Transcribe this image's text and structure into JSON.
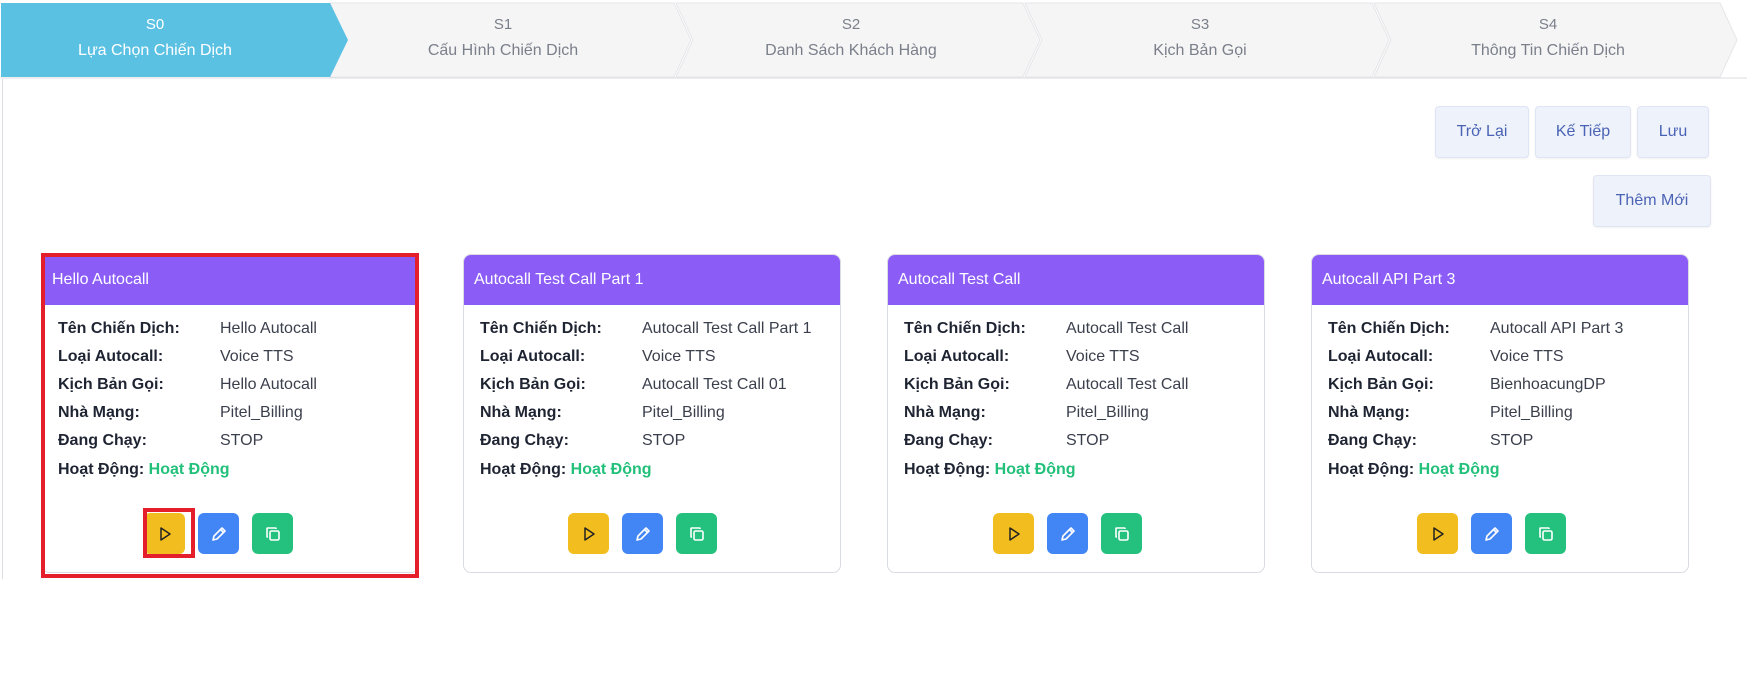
{
  "steps": [
    {
      "code": "S0",
      "name": "Lựa Chọn Chiến Dịch",
      "active": true
    },
    {
      "code": "S1",
      "name": "Cấu Hình Chiến Dịch",
      "active": false
    },
    {
      "code": "S2",
      "name": "Danh Sách Khách Hàng",
      "active": false
    },
    {
      "code": "S3",
      "name": "Kịch Bản Gọi",
      "active": false
    },
    {
      "code": "S4",
      "name": "Thông Tin Chiến Dịch",
      "active": false
    }
  ],
  "actions": {
    "back_label": "Trở Lại",
    "next_label": "Kế Tiếp",
    "save_label": "Lưu",
    "add_label": "Thêm Mới"
  },
  "field_labels": {
    "name": "Tên Chiến Dịch:",
    "type": "Loại Autocall:",
    "script": "Kịch Bản Gọi:",
    "carrier": "Nhà Mạng:",
    "running": "Đang Chạy:",
    "activity": "Hoạt Động:"
  },
  "cards": [
    {
      "title": "Hello Autocall",
      "name": "Hello Autocall",
      "type": "Voice TTS",
      "script": "Hello Autocall",
      "carrier": "Pitel_Billing",
      "running": "STOP",
      "activity": "Hoạt Động"
    },
    {
      "title": "Autocall Test Call Part 1",
      "name": "Autocall Test Call Part 1",
      "type": "Voice TTS",
      "script": "Autocall Test Call 01",
      "carrier": "Pitel_Billing",
      "running": "STOP",
      "activity": "Hoạt Động"
    },
    {
      "title": "Autocall Test Call",
      "name": "Autocall Test Call",
      "type": "Voice TTS",
      "script": "Autocall Test Call",
      "carrier": "Pitel_Billing",
      "running": "STOP",
      "activity": "Hoạt Động"
    },
    {
      "title": "Autocall API Part 3",
      "name": "Autocall API Part 3",
      "type": "Voice TTS",
      "script": "BienhoacungDP",
      "carrier": "Pitel_Billing",
      "running": "STOP",
      "activity": "Hoạt Động"
    }
  ],
  "colors": {
    "step_active": "#5bc1e3",
    "step_inactive": "#f5f5f6",
    "card_header": "#8b5cf6",
    "status_active": "#22c07a",
    "play_button": "#f2bd1e",
    "edit_button": "#4285f4",
    "copy_button": "#24c07e",
    "highlight": "#e41e2a"
  },
  "icons": {
    "play": "play-icon",
    "edit": "pencil-icon",
    "copy": "copy-icon"
  }
}
